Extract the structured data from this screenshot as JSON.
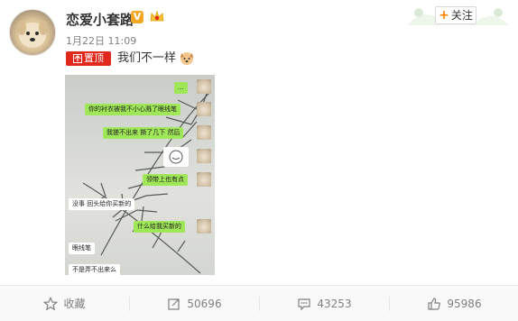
{
  "post": {
    "username": "恋爱小套路",
    "verified_badge": "V",
    "time": "1月22日 11:09",
    "pinned_label": "置顶",
    "text": "我们不一样",
    "follow_label": "关注"
  },
  "chat": {
    "bubbles": [
      {
        "text": "...",
        "side": "right"
      },
      {
        "text": "你的衬衣被我不小心溅了眼线笔",
        "side": "right"
      },
      {
        "text": "我搓不出来 撕了几下 然后",
        "side": "right"
      },
      {
        "text": "领带上也有点",
        "side": "right"
      },
      {
        "text": "没事 回头给你买新的",
        "side": "left"
      },
      {
        "text": "什么给我买新的",
        "side": "right"
      },
      {
        "text": "眼线笔",
        "side": "left"
      },
      {
        "text": "不是弄不出来么",
        "side": "left"
      }
    ]
  },
  "actions": {
    "favorite": "收藏",
    "repost": "50696",
    "comment": "43253",
    "like": "95986"
  },
  "colors": {
    "accent": "#ff8200",
    "pinned": "#e1281d",
    "chat_green": "#9fe658"
  },
  "icons": [
    "star-icon",
    "repost-icon",
    "comment-icon",
    "thumbs-up-icon",
    "plus-icon",
    "pin-icon",
    "crown-icon",
    "dog-emoji-icon"
  ]
}
